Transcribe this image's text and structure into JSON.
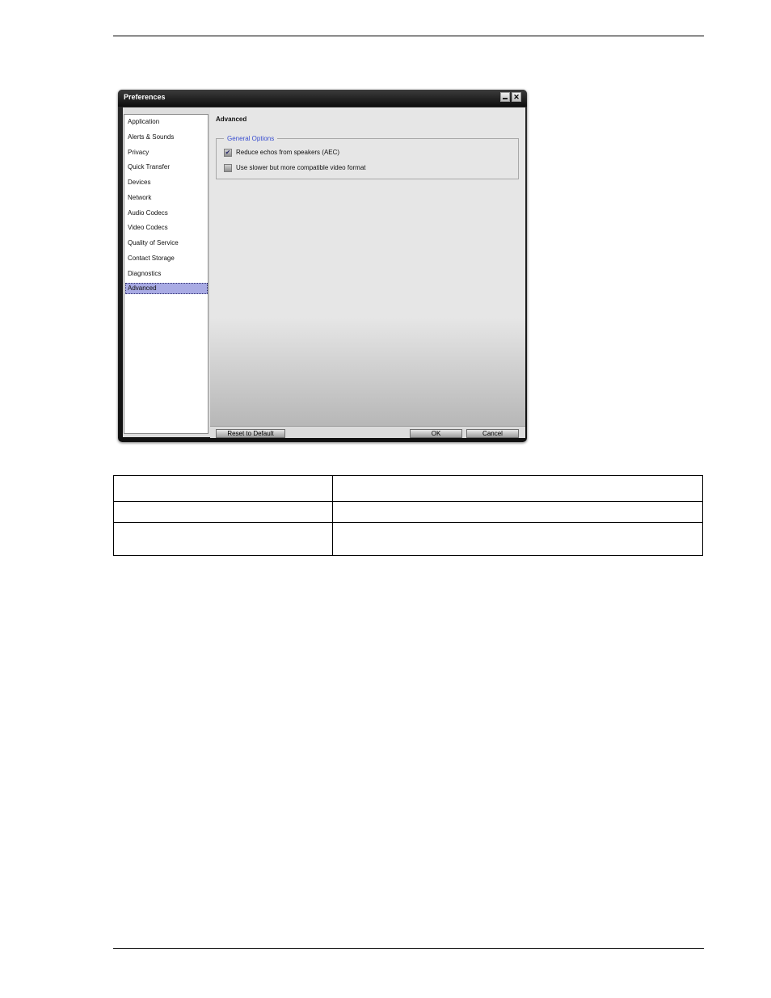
{
  "window": {
    "title": "Preferences",
    "close_glyph": "✕"
  },
  "nav": {
    "items": [
      "Application",
      "Alerts & Sounds",
      "Privacy",
      "Quick Transfer",
      "Devices",
      "Network",
      "Audio Codecs",
      "Video Codecs",
      "Quality of Service",
      "Contact Storage",
      "Diagnostics",
      "Advanced"
    ],
    "selected": "Advanced"
  },
  "content": {
    "title": "Advanced",
    "group_title": "General Options",
    "options": [
      {
        "label": "Reduce echos from speakers (AEC)",
        "checked": true
      },
      {
        "label": "Use slower but more compatible video format",
        "checked": false
      }
    ]
  },
  "buttons": {
    "reset": "Reset to Default",
    "ok": "OK",
    "cancel": "Cancel"
  },
  "table": {
    "rows": [
      [
        "",
        ""
      ],
      [
        "",
        ""
      ],
      [
        "",
        ""
      ]
    ]
  }
}
